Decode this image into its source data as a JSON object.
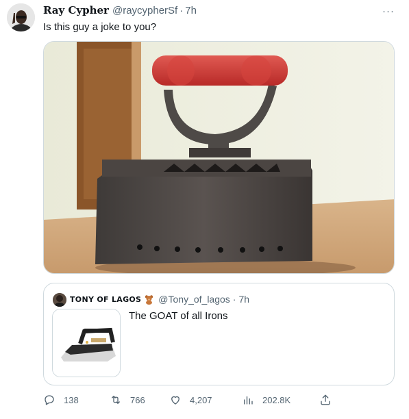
{
  "tweet": {
    "author_name": "Ray Cypher",
    "handle": "@raycypherSf",
    "separator": "·",
    "time": "7h",
    "text": "Is this guy a joke to you?",
    "more_icon": "more-dots-icon",
    "more_glyph": "···"
  },
  "quote": {
    "author_name": "TONY OF LAGOS",
    "handle": "@Tony_of_lagos",
    "separator": "·",
    "time": "7h",
    "text": "The GOAT of all Irons",
    "emoji_icon": "teddy-bear-icon"
  },
  "actions": {
    "replies": "138",
    "retweets": "766",
    "likes": "4,207",
    "views": "202.8K"
  },
  "colors": {
    "text_primary": "#0f1419",
    "text_secondary": "#536471",
    "border": "#cfd9de"
  }
}
